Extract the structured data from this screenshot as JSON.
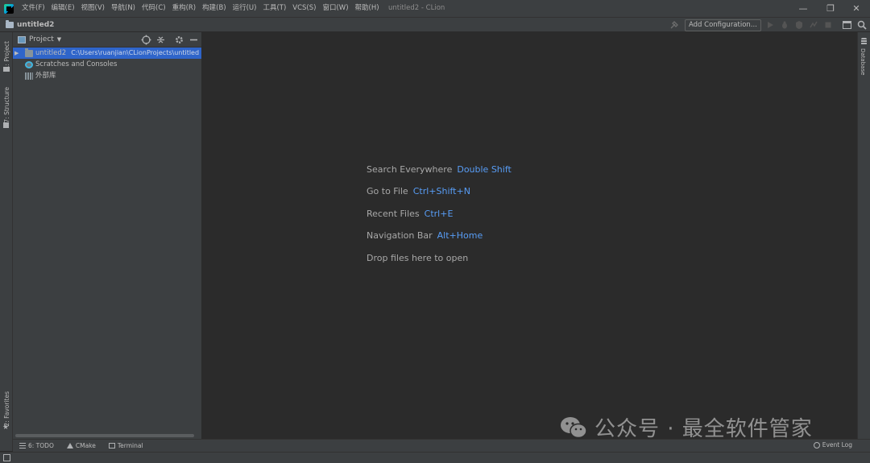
{
  "menu": {
    "items": [
      "文件(F)",
      "编辑(E)",
      "视图(V)",
      "导航(N)",
      "代码(C)",
      "重构(R)",
      "构建(B)",
      "运行(U)",
      "工具(T)",
      "VCS(S)",
      "窗口(W)",
      "帮助(H)"
    ]
  },
  "window": {
    "title": "untitled2 - CLion",
    "minimize": "—",
    "restore": "❐",
    "close": "✕"
  },
  "navbar": {
    "project": "untitled2",
    "add_configuration": "Add Configuration..."
  },
  "left_strip": {
    "project_tab": "1: Project",
    "structure_tab": "7: Structure",
    "favorites_tab": "2: Favorites"
  },
  "project_panel": {
    "view_label": "Project",
    "tree": [
      {
        "label": "untitled2",
        "path": "C:\\Users\\ruanjian\\CLionProjects\\untitled",
        "selected": true,
        "icon": "folder-icon"
      },
      {
        "label": "Scratches and Consoles",
        "path": "",
        "selected": false,
        "icon": "scratch-icon"
      },
      {
        "label": "外部库",
        "path": "",
        "selected": false,
        "icon": "library-icon"
      }
    ]
  },
  "editor": {
    "hints": [
      {
        "text": "Search Everywhere",
        "key": "Double Shift"
      },
      {
        "text": "Go to File",
        "key": "Ctrl+Shift+N"
      },
      {
        "text": "Recent Files",
        "key": "Ctrl+E"
      },
      {
        "text": "Navigation Bar",
        "key": "Alt+Home"
      },
      {
        "text": "Drop files here to open",
        "key": ""
      }
    ]
  },
  "right_strip": {
    "database_tab": "Database"
  },
  "bottom_strip": {
    "todo": "6: TODO",
    "cmake": "CMake",
    "terminal": "Terminal",
    "event_log": "Event Log"
  },
  "watermark": {
    "text": "公众号 · 最全软件管家"
  },
  "colors": {
    "background": "#2b2b2b",
    "panel": "#3c3f41",
    "selection": "#2f65ca",
    "shortcut": "#589df6"
  }
}
